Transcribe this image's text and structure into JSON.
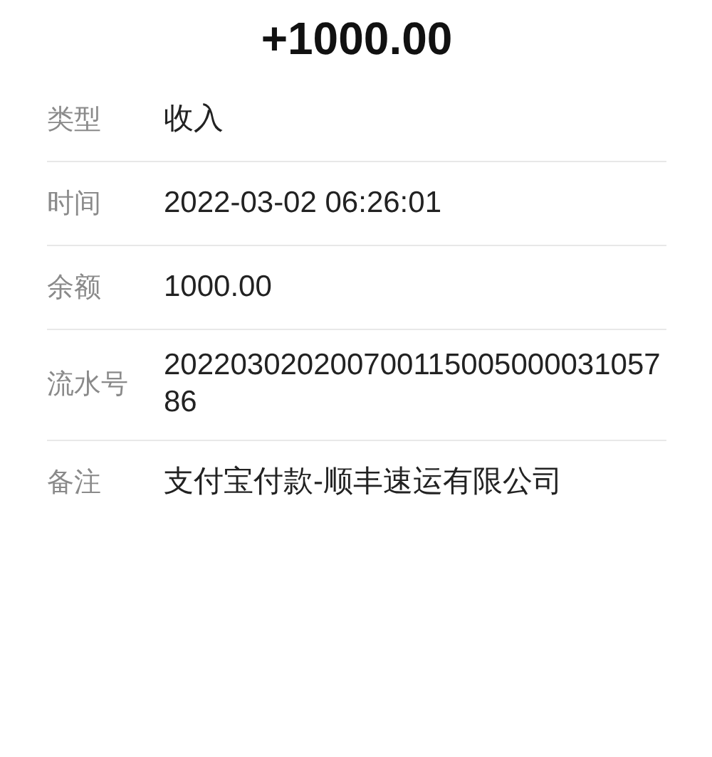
{
  "amount": "+1000.00",
  "details": [
    {
      "label": "类型",
      "value": "收入"
    },
    {
      "label": "时间",
      "value": "2022-03-02 06:26:01"
    },
    {
      "label": "余额",
      "value": "1000.00"
    },
    {
      "label": "流水号",
      "value": "20220302020070011500500003105786"
    },
    {
      "label": "备注",
      "value": "支付宝付款-顺丰速运有限公司"
    }
  ]
}
